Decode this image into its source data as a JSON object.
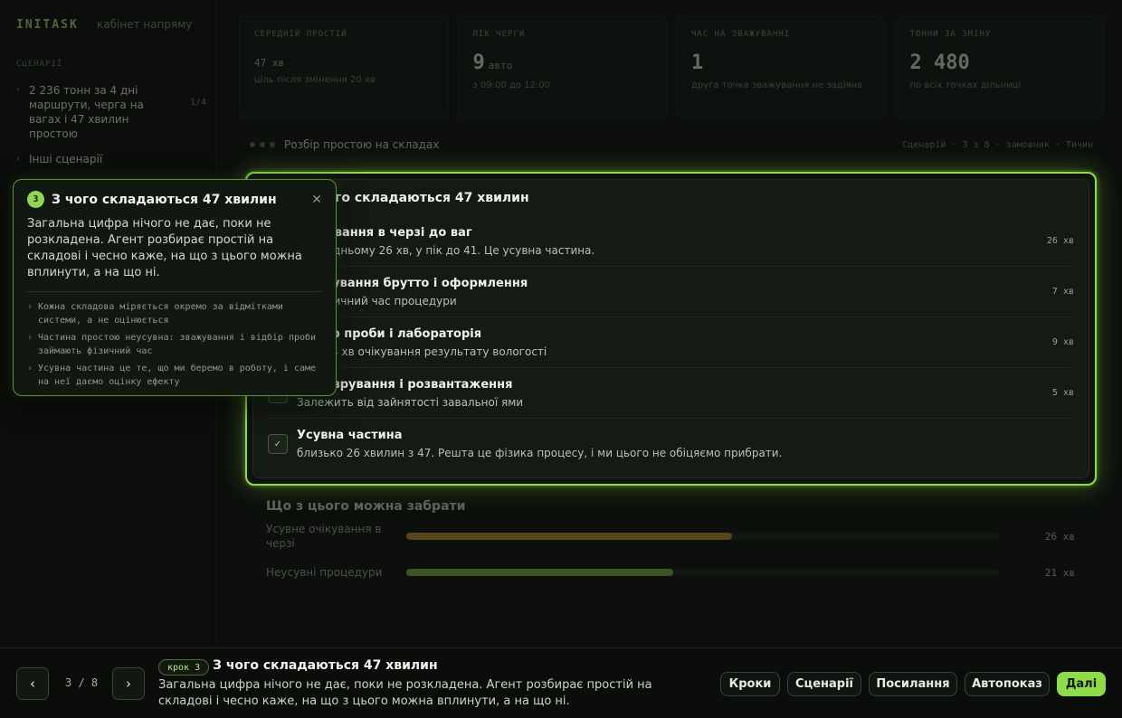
{
  "brand": {
    "name": "INITASK",
    "subtitle": "кабінет напряму"
  },
  "sidebar": {
    "section_label": "СЦЕНАРІЇ",
    "items": [
      {
        "label": "2 236 тонн за 4 дні маршрути, черга на вагах і 47 хвилин простою",
        "count": "1/4"
      },
      {
        "label": "Інші сценарії"
      }
    ]
  },
  "stats": [
    {
      "label": "СЕРЕДНІЙ ПРОСТІЙ",
      "value": "47",
      "unit": "хв",
      "note": "ціль після змінення 20 хв"
    },
    {
      "label": "ПІК ЧЕРГИ",
      "value": "9",
      "unit": "авто",
      "note": "з 09:00 до 12:00"
    },
    {
      "label": "ЧАС НА ЗВАЖУВАННІ",
      "value": "1",
      "unit": "",
      "note": "друга точка зважування не задіяна"
    },
    {
      "label": "ТОННИ ЗА ЗМІНУ",
      "value": "2 480",
      "unit": "",
      "note": "по всіх точках дільниці"
    }
  ],
  "section": {
    "title": "Розбір простою на складах",
    "right": "Сценарій · 3 з 8 · замовник · Тичин"
  },
  "breakdown": {
    "title": "З чого складаються 47 хвилин",
    "rows": [
      {
        "title": "Очікування в черзі до ваг",
        "desc": "У середньому 26 хв, у пік до 41. Це усувна частина.",
        "minutes": "26 хв",
        "check": ""
      },
      {
        "title": "Зважування брутто і оформлення",
        "desc": "Це фізичний час процедури",
        "minutes": "7 хв",
        "check": ""
      },
      {
        "title": "Відбір проби і лабораторія",
        "desc": "З них 4 хв очікування результату вологості",
        "minutes": "9 хв",
        "check": ""
      },
      {
        "title": "Маневрування і розвантаження",
        "desc": "Залежить від зайнятості завальної ями",
        "minutes": "5 хв",
        "check": ""
      },
      {
        "title": "Усувна частина",
        "desc": "близько 26 хвилин з 47. Решта це фізика процесу, і ми цього не обіцяємо прибрати.",
        "minutes": "",
        "check": "✓"
      }
    ]
  },
  "reduction": {
    "title": "Що з цього можна забрати",
    "bars": [
      {
        "label": "Усувне очікування в черзі",
        "value": "26 хв",
        "fraction": 0.55,
        "color": "#c79a2a"
      },
      {
        "label": "Неусувні процедури",
        "value": "21 хв",
        "fraction": 0.45,
        "color": "#7cc043"
      }
    ]
  },
  "tooltip": {
    "number": "3",
    "title": "З чого складаються 47 хвилин",
    "close": "✕",
    "text": "Загальна цифра нічого не дає, поки не розкладена. Агент розбирає простій на складові і чесно каже, на що з цього можна вплинути, а на що ні.",
    "points": [
      "Кожна складова міряється окремо за відмітками системи, а не оцінюється",
      "Частина простою неусувна: зважування і відбір проби займають фізичний час",
      "Усувна частина це те, що ми беремо в роботу, і саме на неї даємо оцінку ефекту"
    ]
  },
  "bottom": {
    "prev": "‹",
    "next": "›",
    "pager": "3 / 8",
    "step_badge": "крок 3",
    "title": "З чого складаються 47 хвилин",
    "text": "Загальна цифра нічого не дає, поки не розкладена. Агент розбирає простій на складові і чесно каже, на що з цього можна вплинути, а на що ні.",
    "buttons": [
      "Кроки",
      "Сценарії",
      "Посилання",
      "Автопоказ",
      "Далі"
    ]
  },
  "colors": {
    "accent": "#8fdc4a",
    "background": "#0c0f0c"
  }
}
